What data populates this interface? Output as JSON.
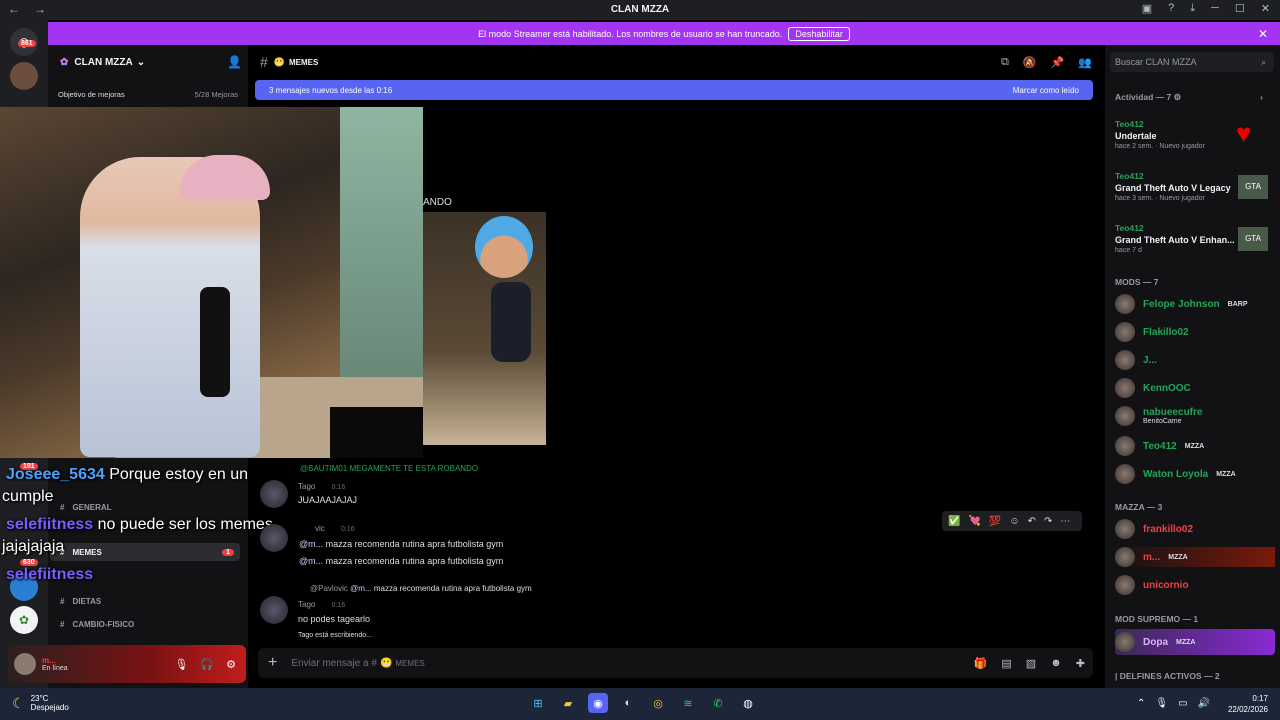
{
  "window": {
    "title": "CLAN MZZA",
    "back": "←",
    "forward": "→",
    "ctrl_min": "─",
    "ctrl_max": "☐",
    "ctrl_close": "✕"
  },
  "streamer_banner": {
    "text": "El modo Streamer está habilitado. Los nombres de usuario se han truncado.",
    "button": "Deshabilitar",
    "close": "✕"
  },
  "servers": {
    "badge_top": "861",
    "badge_bottom1": "191",
    "badge_bottom2": "630"
  },
  "guild": {
    "name": "CLAN MZZA",
    "boost_label": "Objetivo de mejoras",
    "boost_value": "5/28 Mejoras"
  },
  "channel": {
    "name": "MEMES",
    "hash": "#"
  },
  "new_messages": {
    "text": "3 mensajes nuevos desde las 0:16",
    "action": "Marcar como leído"
  },
  "stream": {
    "overlay_text": "ANDO"
  },
  "channels_list": [
    {
      "name": "GENERAL",
      "unread": ""
    },
    {
      "name": "MEMES",
      "unread": "1"
    },
    {
      "name": "DIETAS",
      "unread": ""
    },
    {
      "name": "CAMBIO-FISICO",
      "unread": ""
    }
  ],
  "chat_overlay": [
    {
      "user": "Joseee_5634",
      "text": "Porque estoy en un"
    },
    {
      "user": "",
      "text": "cumple"
    },
    {
      "user": "selefiitness",
      "text": "no puede ser los memes"
    },
    {
      "user": "",
      "text": "jajajajaja"
    },
    {
      "user": "selefiitness",
      "text": ""
    }
  ],
  "messages": {
    "reply1": "@BAUTIM01 MEGAMENTE TE ESTA ROBANDO",
    "m1_user": "Tago",
    "m1_time": "0:16",
    "m1_text": "JUAJAAJAJAJ",
    "m2_user": "vic",
    "m2_time": "0:16",
    "m2_text1": "mazza recomenda rutina apra futbolista gym",
    "m2_text2": "mazza recomenda rutina apra futbolista gym",
    "m2_mention": "@m...",
    "reply3": "@Pavlovic",
    "reply3_text": "mazza recomenda rutina apra futbolista gym",
    "m3_user": "Tago",
    "m3_time": "0:16",
    "m3_text": "no podes tagearlo",
    "typing": "Tago está escribiendo..."
  },
  "composer": {
    "placeholder": "Enviar mensaje a #",
    "channel": "MEMES",
    "plus": "+"
  },
  "user": {
    "name": "m...",
    "status": "En línea"
  },
  "search": {
    "placeholder": "Buscar CLAN MZZA"
  },
  "activity": {
    "header": "Actividad — 7",
    "items": [
      {
        "user": "Teo412",
        "game": "Undertale",
        "time": "hace 2 sem.",
        "extra": "Nuevo jugador"
      },
      {
        "user": "Teo412",
        "game": "Grand Theft Auto V Legacy",
        "time": "hace 3 sem.",
        "extra": "Nuevo jugador"
      },
      {
        "user": "Teo412",
        "game": "Grand Theft Auto V Enhan...",
        "time": "hace 7 d",
        "extra": ""
      }
    ]
  },
  "mods": {
    "header": "MODS — 7",
    "list": [
      {
        "name": "Felope Johnson",
        "tag": "BARP",
        "color": "#23a55a"
      },
      {
        "name": "Flakillo02",
        "tag": "",
        "color": "#23a55a"
      },
      {
        "name": "J...",
        "tag": "",
        "color": "#23a55a"
      },
      {
        "name": "KennOOC",
        "tag": "",
        "color": "#23a55a"
      },
      {
        "name": "nabueecufre",
        "tag": "BenitoCame",
        "color": "#23a55a"
      },
      {
        "name": "Teo412",
        "tag": "MZZA",
        "color": "#23a55a"
      },
      {
        "name": "Waton Loyola",
        "tag": "MZZA",
        "color": "#23a55a"
      }
    ]
  },
  "mazza": {
    "header": "MAZZA — 3",
    "list": [
      {
        "name": "frankillo02",
        "tag": "",
        "color": "#f23f43"
      },
      {
        "name": "m...",
        "tag": "MZZA",
        "color": "#f23f43"
      },
      {
        "name": "unicornio",
        "tag": "",
        "color": "#f23f43"
      }
    ]
  },
  "supremo": {
    "header": "MOD SUPREMO — 1",
    "name": "Dopa",
    "tag": "MZZA"
  },
  "delfines": {
    "header": "| DELFINES ACTIVOS — 2"
  },
  "taskbar": {
    "temp": "23°C",
    "weather": "Despejado",
    "time": "0:17",
    "date": "22/02/2026"
  }
}
